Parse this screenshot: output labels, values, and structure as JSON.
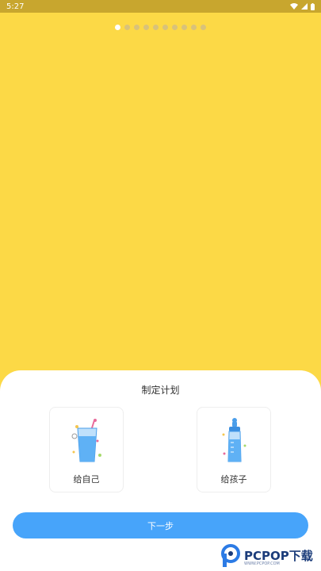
{
  "status_bar": {
    "time": "5:27"
  },
  "pager": {
    "count": 10,
    "active_index": 0
  },
  "sheet": {
    "title": "制定计划",
    "options": [
      {
        "label": "给自己",
        "icon": "drink-cup-icon"
      },
      {
        "label": "给孩子",
        "icon": "baby-bottle-icon"
      }
    ],
    "next_label": "下一步"
  },
  "watermark": {
    "text": "PCPOP下载",
    "sub": "WWW.PCPOP.COM"
  },
  "colors": {
    "background": "#FCD946",
    "accent": "#47A4FA",
    "sheet": "#FFFFFF"
  }
}
